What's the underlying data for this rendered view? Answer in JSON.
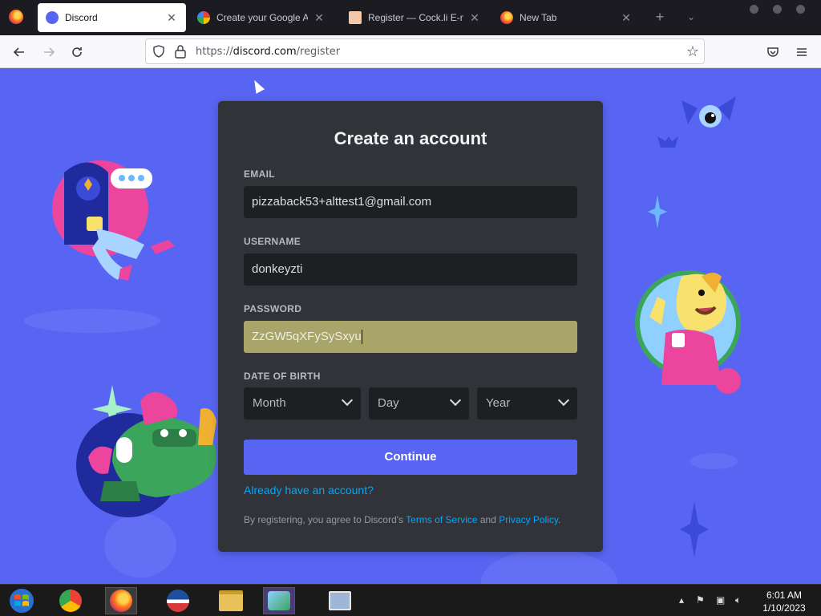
{
  "browser": {
    "tabs": [
      {
        "label": "Discord",
        "favicon": "discord-icon",
        "active": true
      },
      {
        "label": "Create your Google Acco",
        "favicon": "google-icon"
      },
      {
        "label": "Register — Cock.li E-mail",
        "favicon": "mail-icon"
      },
      {
        "label": "New Tab",
        "favicon": "firefox-icon"
      }
    ],
    "new_tab": "+",
    "url_prefix": "https://",
    "url_host": "discord.com",
    "url_path": "/register"
  },
  "form": {
    "title": "Create an account",
    "email_label": "EMAIL",
    "email_value": "pizzaback53+alttest1@gmail.com",
    "username_label": "USERNAME",
    "username_value": "donkeyzti",
    "password_label": "PASSWORD",
    "password_value": "ZzGW5qXFySySxyu",
    "dob_label": "DATE OF BIRTH",
    "month_placeholder": "Month",
    "day_placeholder": "Day",
    "year_placeholder": "Year",
    "continue_label": "Continue",
    "login_link": "Already have an account?",
    "terms_prefix": "By registering, you agree to Discord's ",
    "terms_link": "Terms of Service",
    "terms_and": " and ",
    "privacy_link": "Privacy Policy",
    "terms_suffix": "."
  },
  "taskbar": {
    "time": "6:01 AM",
    "date": "1/10/2023"
  },
  "colors": {
    "discord_blurple": "#5865f2",
    "modal_bg": "#313338",
    "input_bg": "#1e1f22",
    "link": "#00a8fc",
    "autofill": "#a8a46a"
  }
}
